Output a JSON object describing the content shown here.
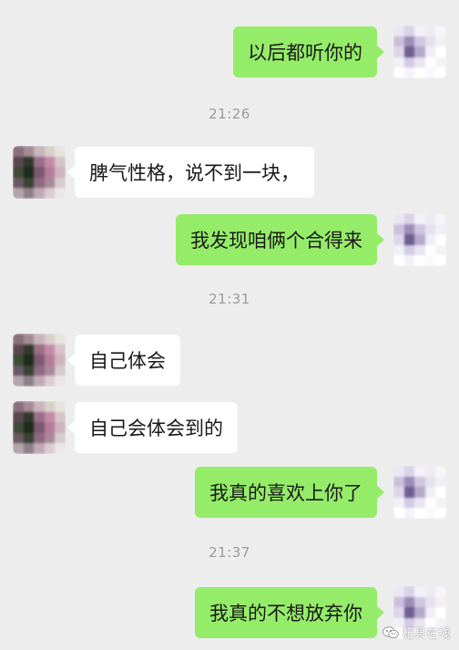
{
  "messages": [
    {
      "side": "right",
      "text": "以后都听你的"
    },
    {
      "type": "time",
      "text": "21:26"
    },
    {
      "side": "left",
      "text": "脾气性格，说不到一块，"
    },
    {
      "side": "right",
      "text": "我发现咱俩个合得来"
    },
    {
      "type": "time",
      "text": "21:31"
    },
    {
      "side": "left",
      "text": "自己体会"
    },
    {
      "side": "left",
      "text": "自己会体会到的"
    },
    {
      "side": "right",
      "text": "我真的喜欢上你了"
    },
    {
      "type": "time",
      "text": "21:37"
    },
    {
      "side": "right",
      "text": "我真的不想放弃你"
    }
  ],
  "watermark": {
    "text": "杞县在线",
    "icon": "wechat-official-account-icon"
  },
  "colors": {
    "background": "#ededed",
    "bubble_self": "#95ec69",
    "bubble_other": "#ffffff",
    "timestamp": "#9b9b9b"
  }
}
